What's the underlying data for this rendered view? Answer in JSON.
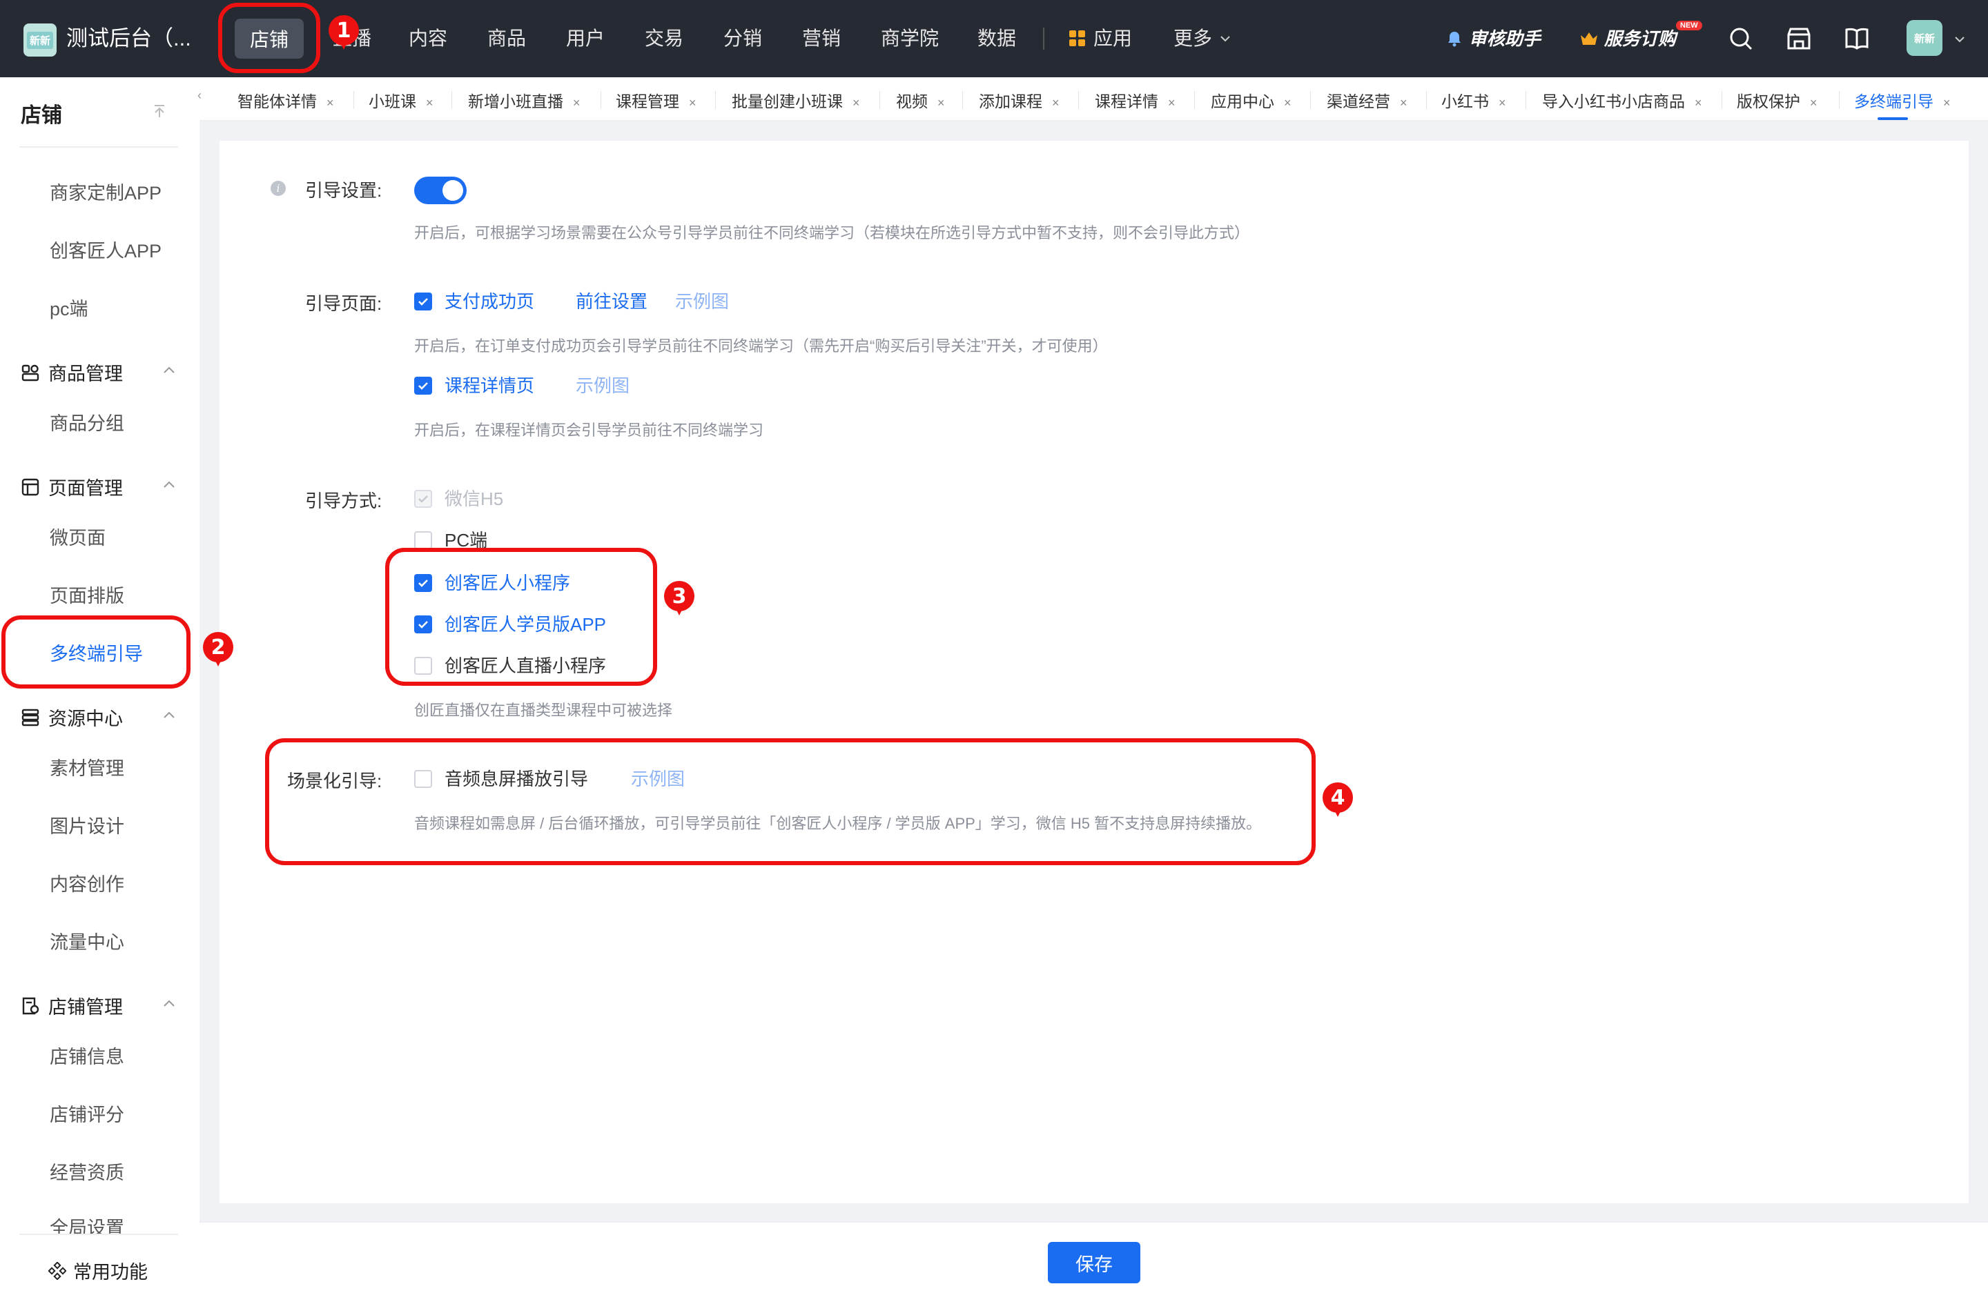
{
  "topnav": {
    "logo_text": "新新",
    "app_title": "测试后台（...",
    "items": [
      {
        "label": "店铺"
      },
      {
        "label": "直播"
      },
      {
        "label": "内容"
      },
      {
        "label": "商品"
      },
      {
        "label": "用户"
      },
      {
        "label": "交易"
      },
      {
        "label": "分销"
      },
      {
        "label": "营销"
      },
      {
        "label": "商学院"
      },
      {
        "label": "数据"
      },
      {
        "label": "应用"
      },
      {
        "label": "更多"
      }
    ],
    "review_helper": "审核助手",
    "service_order": "服务订购",
    "new_badge": "NEW",
    "avatar_text": "新新"
  },
  "sidebar": {
    "title": "店铺",
    "items": {
      "merchant_app": "商家定制APP",
      "creator_app": "创客匠人APP",
      "pc": "pc端",
      "goods_mgmt": "商品管理",
      "goods_group": "商品分组",
      "page_mgmt": "页面管理",
      "micro_page": "微页面",
      "page_layout": "页面排版",
      "multi_guide": "多终端引导",
      "resource_center": "资源中心",
      "material_mgmt": "素材管理",
      "image_design": "图片设计",
      "content_create": "内容创作",
      "traffic_center": "流量中心",
      "shop_mgmt": "店铺管理",
      "shop_info": "店铺信息",
      "shop_rating": "店铺评分",
      "qualification": "经营资质",
      "global_settings": "全局设置"
    },
    "common_functions": "常用功能"
  },
  "tabs": [
    {
      "label": "智能体详情"
    },
    {
      "label": "小班课"
    },
    {
      "label": "新增小班直播"
    },
    {
      "label": "课程管理"
    },
    {
      "label": "批量创建小班课"
    },
    {
      "label": "视频"
    },
    {
      "label": "添加课程"
    },
    {
      "label": "课程详情"
    },
    {
      "label": "应用中心"
    },
    {
      "label": "渠道经营"
    },
    {
      "label": "小红书"
    },
    {
      "label": "导入小红书小店商品"
    },
    {
      "label": "版权保护"
    },
    {
      "label": "多终端引导"
    }
  ],
  "form": {
    "guide_setting": {
      "label": "引导设置:",
      "hint": "开启后，可根据学习场景需要在公众号引导学员前往不同终端学习（若模块在所选引导方式中暂不支持，则不会引导此方式）"
    },
    "guide_page": {
      "label": "引导页面:",
      "pay_success": "支付成功页",
      "goto_settings": "前往设置",
      "example1": "示例图",
      "hint1": "开启后，在订单支付成功页会引导学员前往不同终端学习（需先开启“购买后引导关注”开关，才可使用）",
      "course_detail": "课程详情页",
      "example2": "示例图",
      "hint2": "开启后，在课程详情页会引导学员前往不同终端学习"
    },
    "guide_method": {
      "label": "引导方式:",
      "wechat_h5": "微信H5",
      "pc": "PC端",
      "mini_program": "创客匠人小程序",
      "student_app": "创客匠人学员版APP",
      "live_mini_program": "创客匠人直播小程序",
      "hint": "创匠直播仅在直播类型课程中可被选择"
    },
    "scene_guide": {
      "label": "场景化引导:",
      "audio_screen_off": "音频息屏播放引导",
      "example": "示例图",
      "hint": "音频课程如需息屏 / 后台循环播放，可引导学员前往「创客匠人小程序 / 学员版 APP」学习，微信 H5 暂不支持息屏持续播放。"
    }
  },
  "footer": {
    "save_label": "保存"
  },
  "annotations": {
    "badge1": "1",
    "badge2": "2",
    "badge3": "3",
    "badge4": "4"
  },
  "colors": {
    "accent": "#1a6cf0",
    "topbar": "#262a33",
    "annotation": "#e11111"
  }
}
